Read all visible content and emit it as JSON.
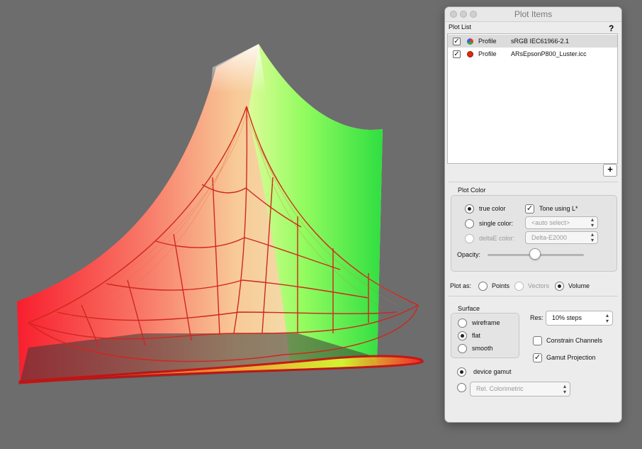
{
  "window": {
    "title": "Plot Items",
    "help": "?"
  },
  "plot_list": {
    "label": "Plot List",
    "items": [
      {
        "checked": true,
        "type": "Profile",
        "name": "sRGB IEC61966-2.1",
        "icon": "multicolor-dot-icon"
      },
      {
        "checked": true,
        "type": "Profile",
        "name": "ARsEpsonP800_Luster.icc",
        "icon": "red-dot-icon"
      }
    ],
    "add_button": "+"
  },
  "plot_color": {
    "label": "Plot Color",
    "true_color": "true color",
    "tone_using_l": "Tone using L*",
    "single_color": "single color:",
    "single_color_value": "<auto select>",
    "deltae_color": "deltaE color:",
    "deltae_value": "Delta-E2000",
    "opacity": "Opacity:",
    "opacity_level": 0.49
  },
  "plot_as": {
    "label": "Plot as:",
    "points": "Points",
    "vectors": "Vectors",
    "volume": "Volume",
    "selected": "Volume"
  },
  "surface": {
    "label": "Surface",
    "wireframe": "wireframe",
    "flat": "flat",
    "smooth": "smooth",
    "selected": "flat"
  },
  "res": {
    "label": "Res:",
    "value": "10% steps"
  },
  "options": {
    "constrain_channels": "Constrain Channels",
    "constrain_checked": false,
    "gamut_projection": "Gamut Projection",
    "gamut_checked": true
  },
  "rendering": {
    "device_gamut": "device gamut",
    "intent": "Rel. Colorimetric"
  },
  "colors": {
    "plot_bg": "#6d6d6d",
    "panel_bg": "#ececec"
  }
}
